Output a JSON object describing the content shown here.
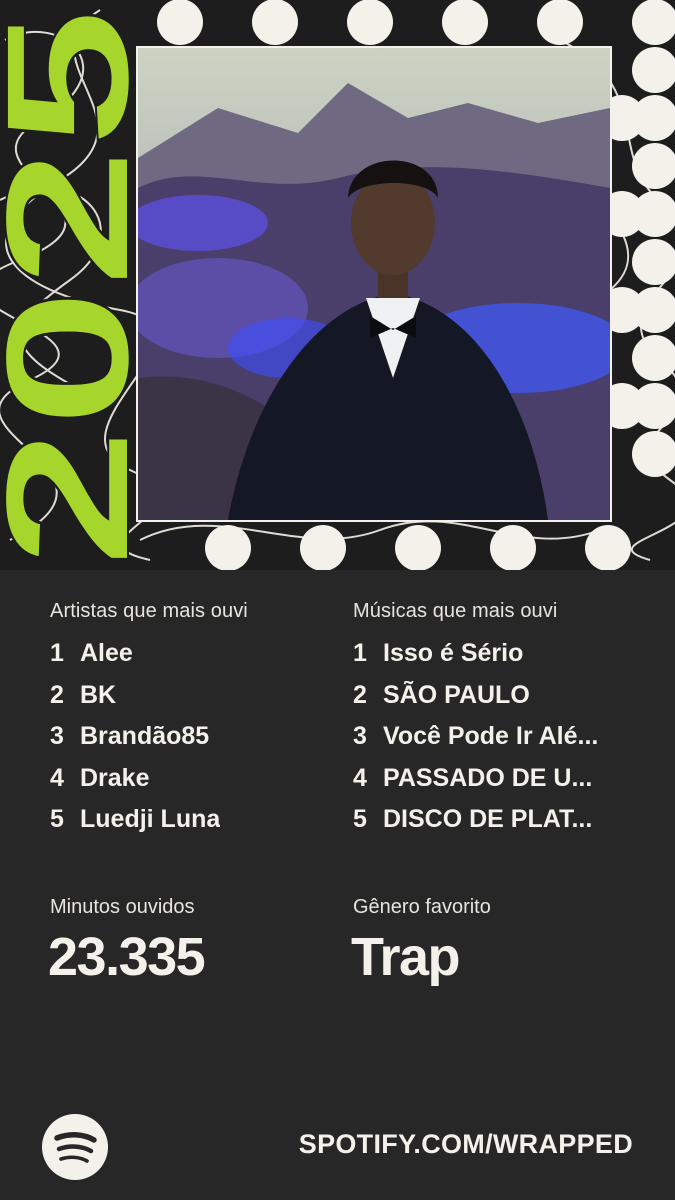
{
  "hero": {
    "year": "2025",
    "photo_icon": "portrait-photo",
    "accent": "#a6d62b",
    "dot_color": "#f4f1ea"
  },
  "top_artists": {
    "title": "Artistas que mais ouvi",
    "items": [
      {
        "rank": "1",
        "name": "Alee"
      },
      {
        "rank": "2",
        "name": "BK"
      },
      {
        "rank": "3",
        "name": "Brandão85"
      },
      {
        "rank": "4",
        "name": "Drake"
      },
      {
        "rank": "5",
        "name": "Luedji Luna"
      }
    ]
  },
  "top_songs": {
    "title": "Músicas que mais ouvi",
    "items": [
      {
        "rank": "1",
        "name": "Isso é Sério"
      },
      {
        "rank": "2",
        "name": "SÃO PAULO"
      },
      {
        "rank": "3",
        "name": "Você Pode Ir Alé..."
      },
      {
        "rank": "4",
        "name": "PASSADO DE U..."
      },
      {
        "rank": "5",
        "name": "DISCO DE PLAT..."
      }
    ]
  },
  "minutes": {
    "label": "Minutos ouvidos",
    "value": "23.335"
  },
  "genre": {
    "label": "Gênero favorito",
    "value": "Trap"
  },
  "footer": {
    "logo_icon": "spotify-logo-icon",
    "url": "SPOTIFY.COM/WRAPPED"
  }
}
